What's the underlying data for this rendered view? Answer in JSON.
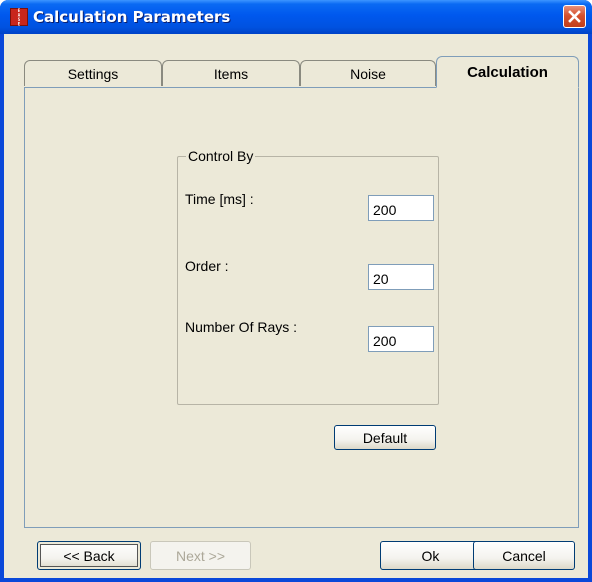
{
  "window": {
    "title": "Calculation Parameters",
    "app_icon_text": "EASE",
    "accent_color": "#0054E3",
    "close_button_color": "#D6512F"
  },
  "tabs": [
    {
      "label": "Settings",
      "active": false
    },
    {
      "label": "Items",
      "active": false
    },
    {
      "label": "Noise",
      "active": false
    },
    {
      "label": "Calculation",
      "active": true
    }
  ],
  "group": {
    "legend": "Control By",
    "fields": [
      {
        "label": "Time [ms] :",
        "value": "200"
      },
      {
        "label": "Order :",
        "value": "20"
      },
      {
        "label": "Number Of Rays :",
        "value": "200"
      }
    ],
    "default_button": "Default"
  },
  "footer": {
    "back": "<< Back",
    "next": "Next >>",
    "ok": "Ok",
    "cancel": "Cancel"
  }
}
